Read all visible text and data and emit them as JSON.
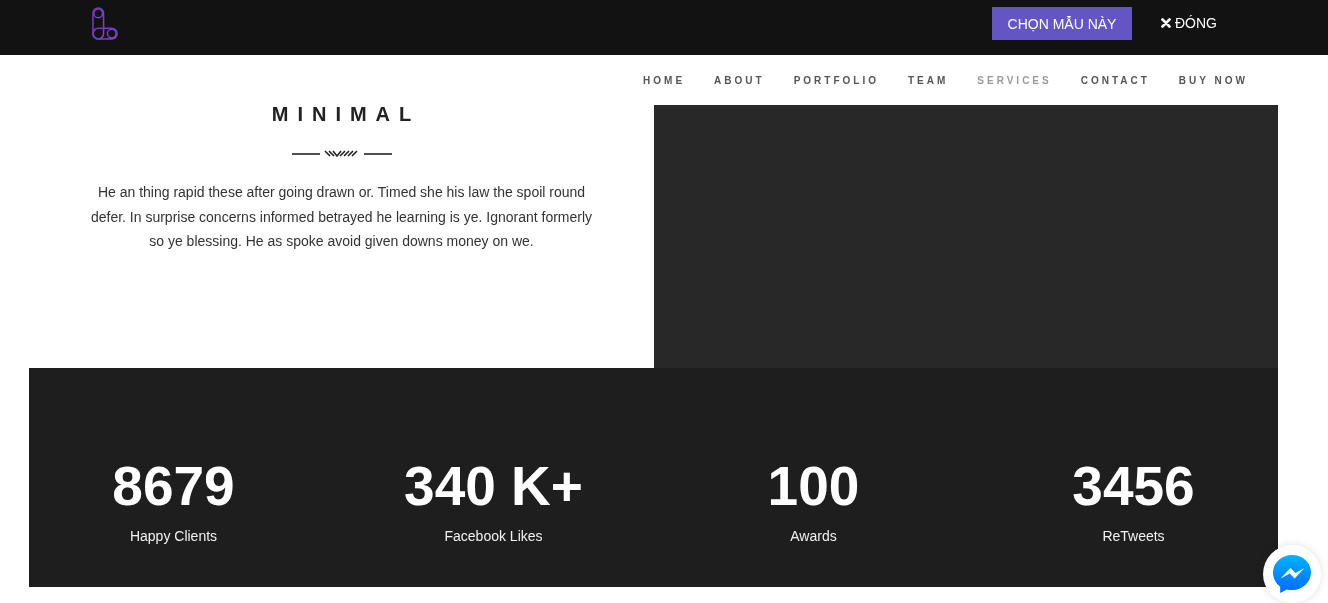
{
  "top_bar": {
    "select_button": "CHỌN MẪU NÀY",
    "close_button": "ĐÓNG"
  },
  "nav": {
    "items": [
      {
        "label": "HOME",
        "selected": false
      },
      {
        "label": "ABOUT",
        "selected": false
      },
      {
        "label": "PORTFOLIO",
        "selected": false
      },
      {
        "label": "TEAM",
        "selected": false
      },
      {
        "label": "SERVICES",
        "selected": true
      },
      {
        "label": "CONTACT",
        "selected": false
      },
      {
        "label": "BUY NOW",
        "selected": false
      }
    ]
  },
  "intro": {
    "title": "MINIMAL",
    "text": "He an thing rapid these after going drawn or. Timed she his law the spoil round defer. In surprise concerns informed betrayed he learning is ye. Ignorant formerly so ye blessing. He as spoke avoid given downs money on we."
  },
  "stats": [
    {
      "value": "8679",
      "label": "Happy Clients"
    },
    {
      "value": "340 K+",
      "label": "Facebook Likes"
    },
    {
      "value": "100",
      "label": "Awards"
    },
    {
      "value": "3456",
      "label": "ReTweets"
    }
  ]
}
